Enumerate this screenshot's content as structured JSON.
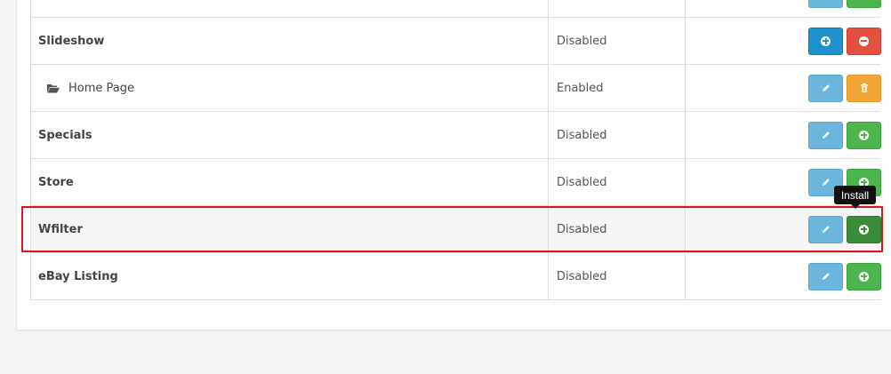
{
  "rows": [
    {
      "name": "",
      "status": "",
      "actions": [
        "edit",
        "install"
      ]
    },
    {
      "name": "Slideshow",
      "status": "Disabled",
      "actions": [
        "install-primary",
        "uninstall"
      ]
    },
    {
      "name": "Home Page",
      "status": "Enabled",
      "actions": [
        "edit",
        "delete"
      ]
    },
    {
      "name": "Specials",
      "status": "Disabled",
      "actions": [
        "edit",
        "install"
      ]
    },
    {
      "name": "Store",
      "status": "Disabled",
      "actions": [
        "edit",
        "install"
      ]
    },
    {
      "name": "Wfilter",
      "status": "Disabled",
      "actions": [
        "edit",
        "install"
      ]
    },
    {
      "name": "eBay Listing",
      "status": "Disabled",
      "actions": [
        "edit",
        "install"
      ]
    }
  ],
  "tooltip": {
    "text": "Install"
  },
  "icons": {
    "edit": "pencil-icon",
    "install": "plus-circle-icon",
    "uninstall": "minus-circle-icon",
    "delete": "trash-icon",
    "folder": "folder-open-icon"
  },
  "colors": {
    "primary": "#1e91cf",
    "danger": "#e3503e",
    "info": "#6cb6de",
    "warning": "#f3a638",
    "success": "#4cb64c",
    "success_active": "#3a8c3a",
    "highlight": "#e1141c"
  }
}
